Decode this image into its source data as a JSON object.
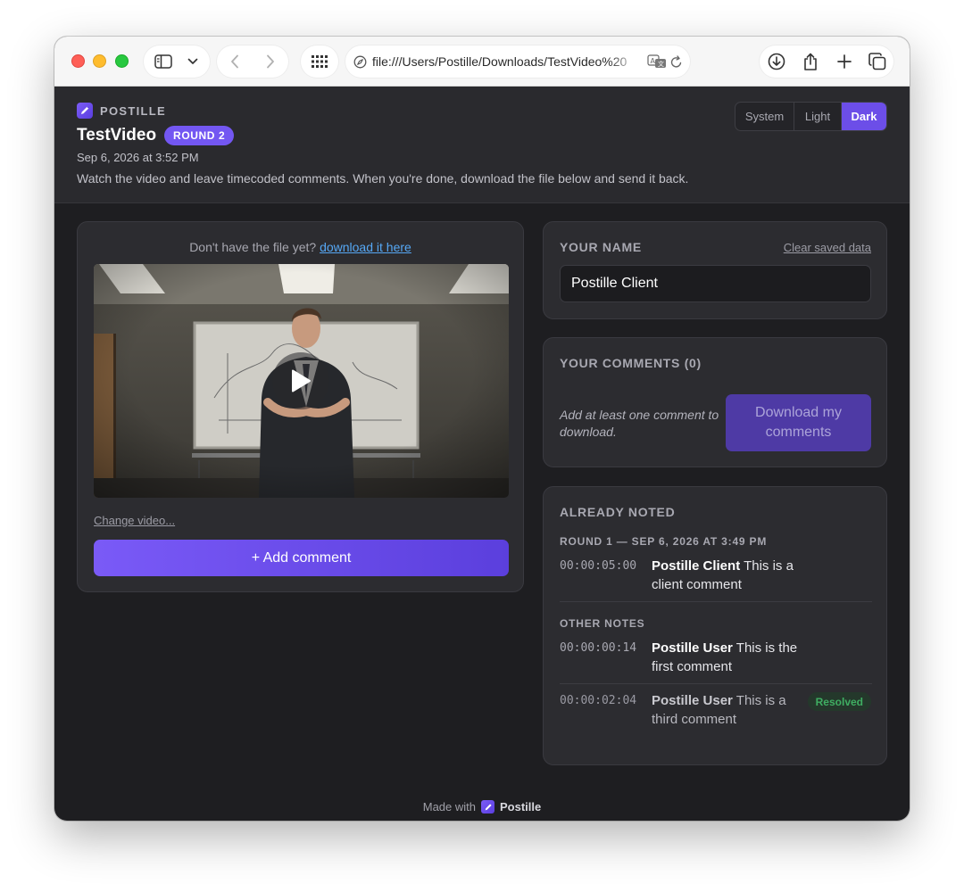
{
  "browser": {
    "url": "file:///Users/Postille/Downloads/TestVideo%20"
  },
  "app": {
    "brand": "POSTILLE",
    "title": "TestVideo",
    "round_badge": "ROUND 2",
    "date": "Sep 6, 2026 at 3:52 PM",
    "instructions": "Watch the video and leave timecoded comments. When you're done, download the file below and send it back.",
    "theme": {
      "options": [
        "System",
        "Light",
        "Dark"
      ],
      "selected": "Dark"
    },
    "accent_color": "#6c4ee8"
  },
  "video_panel": {
    "prompt": "Don't have the file yet?",
    "download_link": "download it here",
    "change_video": "Change video...",
    "add_comment": "+ Add comment"
  },
  "name_panel": {
    "label": "YOUR NAME",
    "clear_link": "Clear saved data",
    "name_value": "Postille Client"
  },
  "comments_panel": {
    "label": "YOUR COMMENTS (0)",
    "hint": "Add at least one comment to download.",
    "download_button": "Download my comments"
  },
  "noted_panel": {
    "label": "ALREADY NOTED",
    "round_heading": "ROUND 1 — SEP 6, 2026 AT 3:49 PM",
    "round_notes": [
      {
        "timecode": "00:00:05:00",
        "author": "Postille Client",
        "text": "This is a client comment"
      }
    ],
    "other_heading": "OTHER NOTES",
    "other_notes": [
      {
        "timecode": "00:00:00:14",
        "author": "Postille User",
        "text": "This is the first comment"
      },
      {
        "timecode": "00:00:02:04",
        "author": "Postille User",
        "text": "This is a third comment",
        "status": "Resolved"
      }
    ]
  },
  "footer": {
    "made_with": "Made with",
    "product": "Postille"
  }
}
